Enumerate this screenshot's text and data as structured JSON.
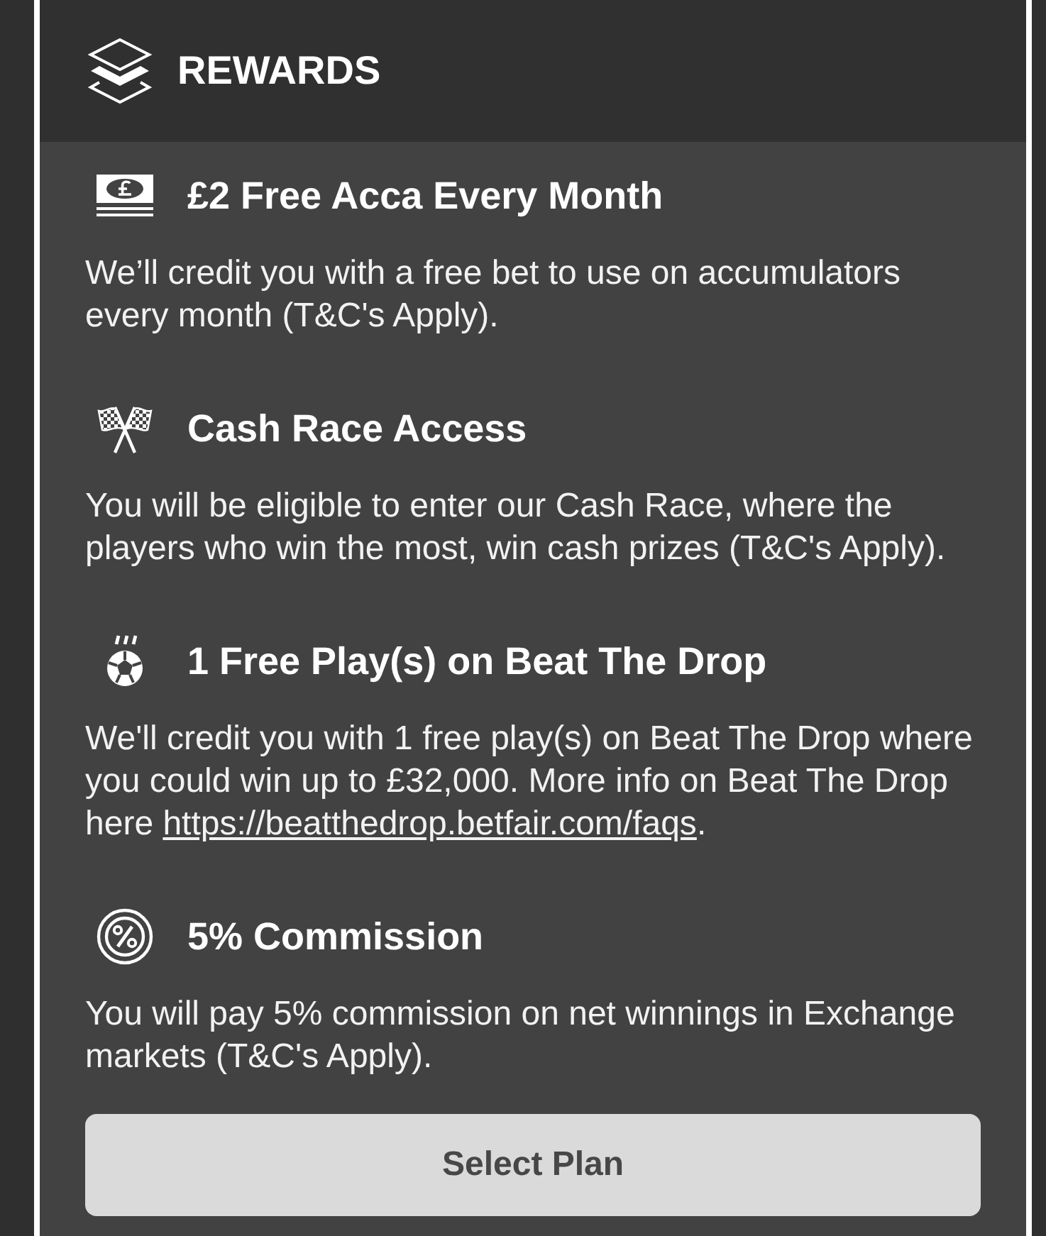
{
  "header": {
    "title": "REWARDS"
  },
  "rewards": [
    {
      "kind": "free_bet",
      "title": "£2 Free Acca Every Month",
      "description": "We’ll credit you with a free bet to use on accumulators every month (T&C's Apply)."
    },
    {
      "kind": "cash_race",
      "title": "Cash Race Access",
      "description": "You will be eligible to enter our Cash Race, where the players who win the most, win cash prizes (T&C's Apply)."
    },
    {
      "kind": "free_play",
      "title": "1 Free Play(s) on Beat The Drop",
      "description": "We'll credit you with 1 free play(s) on Beat The Drop where you could win up to £32,000. More info on Beat The Drop here ",
      "link": "https://beatthedrop.betfair.com/faqs",
      "after_link": "."
    },
    {
      "kind": "commission",
      "title": "5% Commission",
      "description": "You will pay 5% commission on net winnings in Exchange markets (T&C's Apply)."
    }
  ],
  "button": {
    "label": "Select Plan"
  }
}
